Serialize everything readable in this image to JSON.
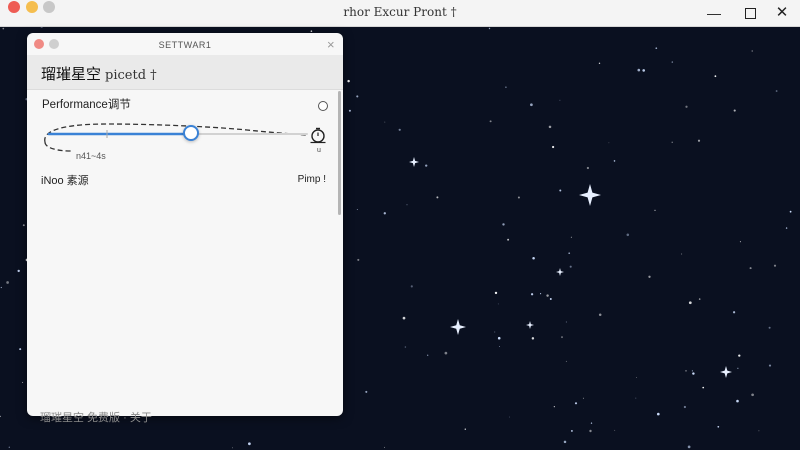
{
  "window": {
    "title": "rhor Excur Pront †",
    "controls": {
      "minimize": "—",
      "close": "✕"
    }
  },
  "panel": {
    "title": "SETTWAR1",
    "close_glyph": "×",
    "app_name": "瑠璀星空",
    "app_name_suffix": "picetd †",
    "performance_label": "Performance调节",
    "slider": {
      "value": 0.55,
      "range_label": "n41~4s"
    },
    "timer_label": "u",
    "mode_label": "iNoo 素源",
    "mode_value": "Pimp !"
  },
  "footer_text": "瑠璀星空 免费版 · 关于",
  "colors": {
    "background": "#0a1020",
    "accent": "#3a82d6",
    "panel": "#f7f7f7"
  },
  "icons": {
    "timer": "timer-icon",
    "radio": "radio-icon"
  }
}
